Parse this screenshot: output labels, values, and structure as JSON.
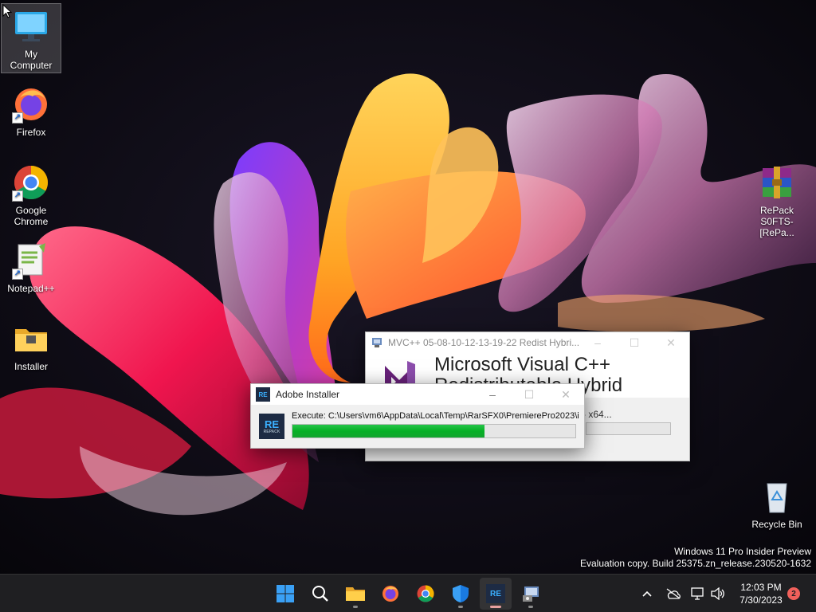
{
  "desktop": {
    "icons": [
      {
        "label": "My Computer"
      },
      {
        "label": "Firefox"
      },
      {
        "label": "Google Chrome"
      },
      {
        "label": "Notepad++"
      },
      {
        "label": "Installer"
      },
      {
        "label": "RePack S0FTS-[RePa..."
      },
      {
        "label": "Recycle Bin"
      }
    ],
    "watermark": {
      "line1": "Windows 11 Pro Insider Preview",
      "line2": "Evaluation copy. Build 25375.zn_release.230520-1632"
    }
  },
  "vc_window": {
    "title": "MVC++ 05-08-10-12-13-19-22 Redist Hybri...",
    "heading": "Microsoft Visual C++ Redistributable Hybrid",
    "status": "- x64..."
  },
  "adobe_window": {
    "title": "Adobe Installer",
    "logo_text": "RE",
    "execute_text": "Execute: C:\\Users\\vm6\\AppData\\Local\\Temp\\RarSFX0\\PremierePro2023\\in",
    "progress": 0.68,
    "progress_color": "#06b025"
  },
  "taskbar": {
    "pinned": [
      {
        "name": "start-button",
        "icon": "windows-logo-icon"
      },
      {
        "name": "search-button",
        "icon": "search-icon"
      },
      {
        "name": "file-explorer-button",
        "icon": "folder-icon"
      },
      {
        "name": "firefox-taskbar-button",
        "icon": "firefox-icon"
      },
      {
        "name": "chrome-taskbar-button",
        "icon": "chrome-icon"
      },
      {
        "name": "windows-security-button",
        "icon": "shield-icon"
      },
      {
        "name": "adobe-installer-taskbar-button",
        "icon": "repack-icon"
      },
      {
        "name": "vc-installer-taskbar-button",
        "icon": "installer-icon"
      }
    ],
    "clock": {
      "time": "12:03 PM",
      "date": "7/30/2023"
    },
    "notification_count": "2"
  }
}
